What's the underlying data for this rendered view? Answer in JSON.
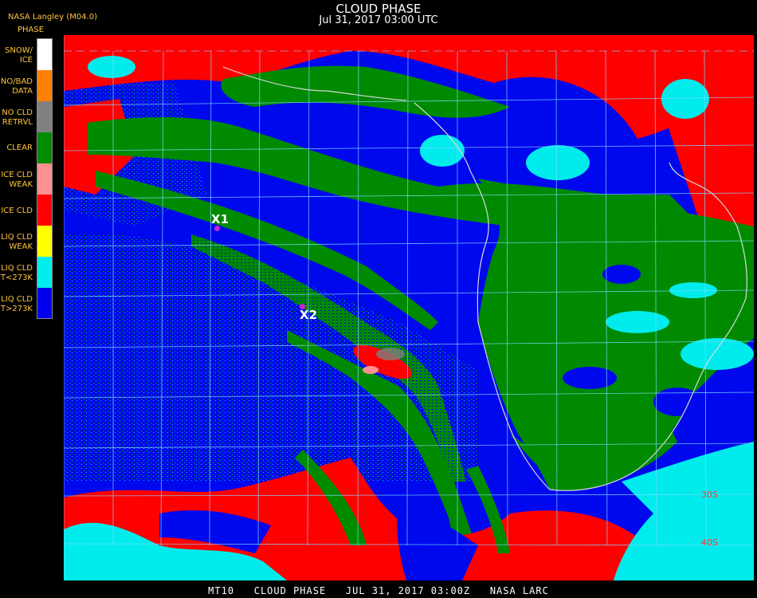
{
  "header": {
    "title": "CLOUD PHASE",
    "subtitle": "Jul 31, 2017 03:00 UTC",
    "provider": "NASA Langley (M04.0)"
  },
  "legend": {
    "title": "PHASE",
    "items": [
      {
        "line1": "SNOW/",
        "line2": "ICE",
        "color": "#ffffff"
      },
      {
        "line1": "NO/BAD",
        "line2": "DATA",
        "color": "#ff7f00"
      },
      {
        "line1": "NO CLD",
        "line2": "RETRVL",
        "color": "#808080"
      },
      {
        "line1": "CLEAR",
        "line2": "",
        "color": "#008c00"
      },
      {
        "line1": "ICE CLD",
        "line2": "WEAK",
        "color": "#ff9090"
      },
      {
        "line1": "ICE CLD",
        "line2": "",
        "color": "#ff0000"
      },
      {
        "line1": "LIQ CLD",
        "line2": "WEAK",
        "color": "#ffff00"
      },
      {
        "line1": "LIQ CLD",
        "line2": "T<273K",
        "color": "#00eeee"
      },
      {
        "line1": "LIQ CLD",
        "line2": "T>273K",
        "color": "#0000ee"
      }
    ]
  },
  "markers": [
    {
      "label": "X1",
      "color": "#d020d0"
    },
    {
      "label": "X2",
      "color": "#d020d0"
    }
  ],
  "grid_labels": [
    "30S",
    "40S"
  ],
  "colors": {
    "ocean_liquid_warm": "#0008ee",
    "liquid_cold": "#00ecec",
    "clear": "#008a00",
    "ice": "#ff0000",
    "grid": "#7fd8ff",
    "coast": "#d9d9d9"
  },
  "footer": "MT10   CLOUD PHASE   JUL 31, 2017 03:00Z   NASA LARC"
}
